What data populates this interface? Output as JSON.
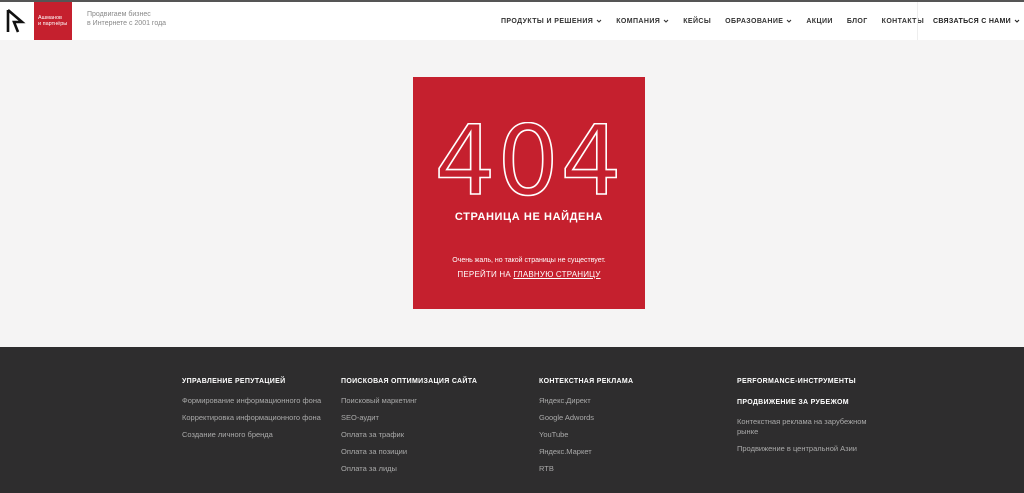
{
  "header": {
    "logo_lines": [
      "Ашманов",
      "и партнёры"
    ],
    "tagline": [
      "Продвигаем бизнес",
      "в Интернете с 2001 года"
    ],
    "nav": [
      {
        "label": "ПРОДУКТЫ И РЕШЕНИЯ",
        "has_dropdown": true
      },
      {
        "label": "КОМПАНИЯ",
        "has_dropdown": true
      },
      {
        "label": "КЕЙСЫ",
        "has_dropdown": false
      },
      {
        "label": "ОБРАЗОВАНИЕ",
        "has_dropdown": true
      },
      {
        "label": "АКЦИИ",
        "has_dropdown": false
      },
      {
        "label": "БЛОГ",
        "has_dropdown": false
      },
      {
        "label": "КОНТАКТЫ",
        "has_dropdown": false
      }
    ],
    "contact_label": "СВЯЗАТЬСЯ С НАМИ"
  },
  "error": {
    "code": "404",
    "title": "СТРАНИЦА НЕ НАЙДЕНА",
    "message": "Очень жаль, но такой страницы не существует.",
    "goto_prefix": "ПЕРЕЙТИ НА ",
    "goto_link": "ГЛАВНУЮ СТРАНИЦУ"
  },
  "footer": {
    "col1": {
      "heading": "УПРАВЛЕНИЕ РЕПУТАЦИЕЙ",
      "links": [
        "Формирование информационного фона",
        "Корректировка информационного фона",
        "Создание личного бренда"
      ]
    },
    "col2": {
      "heading": "ПОИСКОВАЯ ОПТИМИЗАЦИЯ САЙТА",
      "links": [
        "Поисковый маркетинг",
        "SEO-аудит",
        "Оплата за трафик",
        "Оплата за позиции",
        "Оплата за лиды"
      ]
    },
    "col3": {
      "heading": "КОНТЕКСТНАЯ РЕКЛАМА",
      "links": [
        "Яндекс.Директ",
        "Google Adwords",
        "YouTube",
        "Яндекс.Маркет",
        "RTB"
      ]
    },
    "col4": {
      "heading": "PERFORMANCE-ИНСТРУМЕНТЫ",
      "heading2": "ПРОДВИЖЕНИЕ ЗА РУБЕЖОМ",
      "links": [
        "Контекстная реклама на зарубежном рынке",
        "Продвижение в центральной Азии"
      ]
    }
  },
  "colors": {
    "brand_red": "#c5202e",
    "footer_bg": "#2e2d2e"
  }
}
